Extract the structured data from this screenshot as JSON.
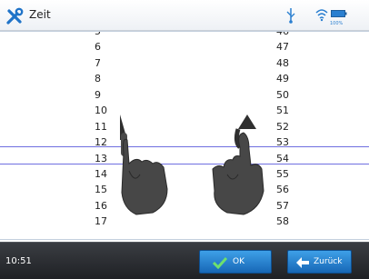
{
  "header": {
    "title": "Zeit",
    "left_icon": "tools-icon",
    "status_icons": [
      "usb-icon",
      "wifi-icon",
      "battery-icon"
    ],
    "battery_label": "100%"
  },
  "picker": {
    "hours": [
      "5",
      "6",
      "7",
      "8",
      "9",
      "10",
      "11",
      "12",
      "13",
      "14",
      "15",
      "16",
      "17"
    ],
    "minutes": [
      "46",
      "47",
      "48",
      "49",
      "50",
      "51",
      "52",
      "53",
      "54",
      "55",
      "56",
      "57",
      "58"
    ],
    "selected_hour": "10",
    "selected_minute": "51",
    "highlight_color": "#6f6fe0",
    "gesture_icons": [
      "swipe-down-hand-icon",
      "swipe-up-hand-icon"
    ]
  },
  "footer": {
    "clock": "10:51",
    "ok_label": "OK",
    "back_label": "Zurück",
    "button_color": "#2a86d6"
  }
}
